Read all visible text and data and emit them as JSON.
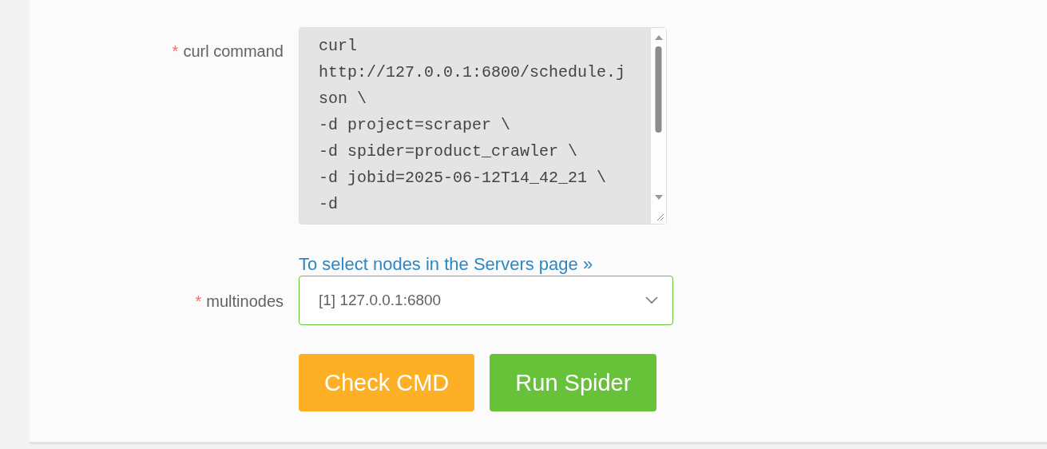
{
  "form": {
    "fields": [
      {
        "kind": "textarea",
        "required_mark": "*",
        "label": "curl command",
        "lines": [
          "curl",
          "http://127.0.0.1:6800/schedule.j",
          "son \\",
          "-d project=scraper \\",
          "-d spider=product_crawler \\",
          "-d jobid=2025-06-12T14_42_21 \\",
          "-d"
        ]
      },
      {
        "kind": "select",
        "required_mark": "*",
        "label": "multinodes",
        "link": "To select nodes in the Servers page »",
        "value": "[1] 127.0.0.1:6800",
        "valid": true
      }
    ],
    "buttons": [
      {
        "kind": "warning",
        "label": "Check CMD"
      },
      {
        "kind": "success",
        "label": "Run Spider"
      }
    ]
  }
}
